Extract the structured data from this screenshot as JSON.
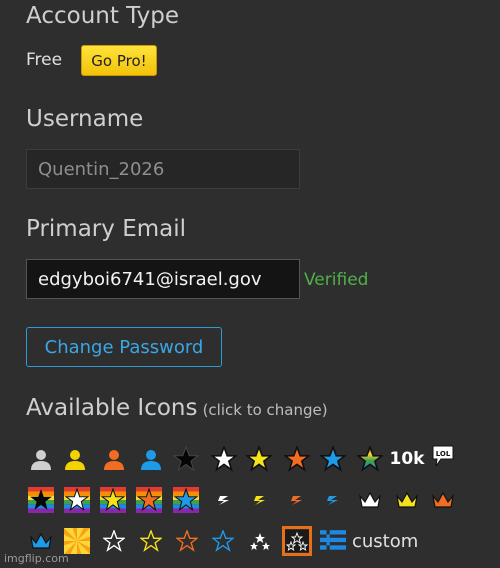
{
  "account": {
    "section_title": "Account Type",
    "plan": "Free",
    "upgrade_label": "Go Pro!"
  },
  "username": {
    "section_title": "Username",
    "value": "Quentin_2026"
  },
  "email": {
    "section_title": "Primary Email",
    "value": "edgyboi6741@israel.gov",
    "status": "Verified"
  },
  "password": {
    "change_label": "Change Password"
  },
  "icons": {
    "section_title": "Available Icons",
    "hint": "(click to change)",
    "custom_label": "custom",
    "selected": "dotted-stars-icon",
    "row1": [
      "user-gray-icon",
      "user-yellow-icon",
      "user-orange-icon",
      "user-blue-icon",
      "star-black-icon",
      "star-white-icon",
      "star-yellow-icon",
      "star-orange-icon",
      "star-blue-icon",
      "star-rainbow-icon",
      "10k-badge-icon",
      "lol-bubble-icon"
    ],
    "row2": [
      "rainbow-star-black-icon",
      "rainbow-star-white-icon",
      "rainbow-star-yellow-icon",
      "rainbow-star-orange-icon",
      "rainbow-star-blue-icon",
      "lightning-white-icon",
      "lightning-yellow-icon",
      "lightning-orange-icon",
      "lightning-blue-icon",
      "crown-white-icon",
      "crown-yellow-icon",
      "crown-orange-icon"
    ],
    "row3": [
      "crown-blue-icon",
      "sunburst-icon",
      "outline-star-white-icon",
      "outline-star-yellow-icon",
      "outline-star-orange-icon",
      "outline-star-blue-icon",
      "small-stars-icon",
      "dotted-stars-icon",
      "custom-pixel-icon"
    ],
    "ten_k_text": "10k",
    "lol_text": "LOL"
  },
  "colors": {
    "background": "#2e2e2e",
    "pro_button": "#f5c80f",
    "verified": "#4fb14a",
    "link": "#3ba6e6",
    "selected_border": "#e86f1a"
  },
  "watermark": "imgflip.com"
}
